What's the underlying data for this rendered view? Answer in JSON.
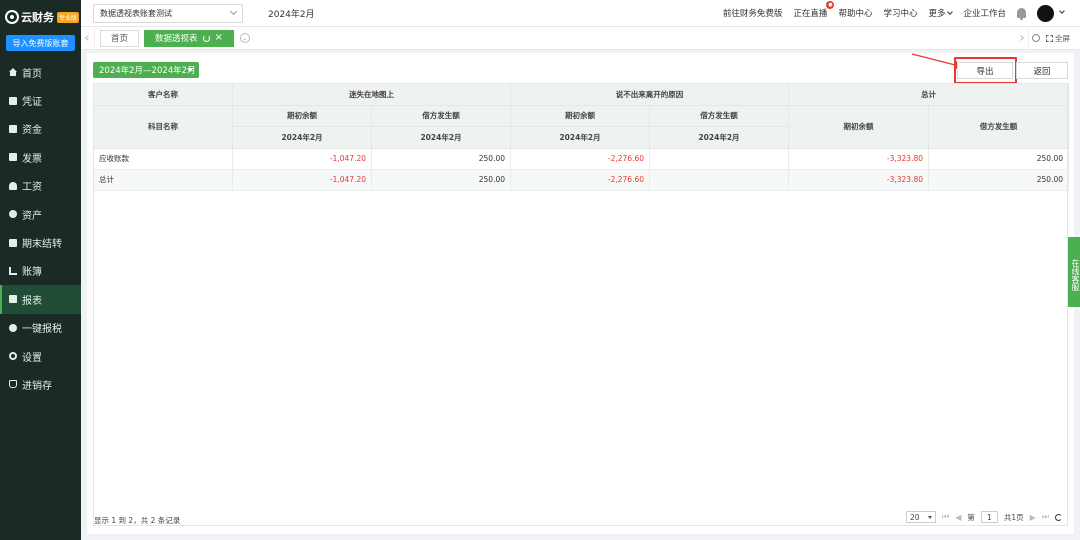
{
  "brand": {
    "name": "云财务",
    "badge": "专业版"
  },
  "sidebar": {
    "import_label": "导入免费版账套",
    "items": [
      {
        "label": "首页",
        "icon": "house-icon"
      },
      {
        "label": "凭证",
        "icon": "document-icon"
      },
      {
        "label": "资金",
        "icon": "wallet-icon"
      },
      {
        "label": "发票",
        "icon": "invoice-icon"
      },
      {
        "label": "工资",
        "icon": "person-icon"
      },
      {
        "label": "资产",
        "icon": "asset-icon"
      },
      {
        "label": "期末结转",
        "icon": "closing-icon"
      },
      {
        "label": "账簿",
        "icon": "ledger-icon"
      },
      {
        "label": "报表",
        "icon": "report-icon",
        "active": true
      },
      {
        "label": "一键报税",
        "icon": "tax-icon"
      },
      {
        "label": "设置",
        "icon": "gear-icon"
      },
      {
        "label": "进销存",
        "icon": "inventory-icon"
      }
    ]
  },
  "topbar": {
    "account": "数据透视表账套测试",
    "period": "2024年2月",
    "links": {
      "free_version": "前往财务免费版",
      "live": "正在直播",
      "help": "帮助中心",
      "learn": "学习中心",
      "more": "更多",
      "workbench": "企业工作台"
    }
  },
  "tabs": {
    "home": "首页",
    "active": "数据透视表",
    "fullscreen": "全屏"
  },
  "toolbar": {
    "period_range": "2024年2月—2024年2月",
    "export": "导出",
    "back": "返回"
  },
  "table": {
    "header_row1": {
      "customer": "客户名称",
      "group1": "迷失在地图上",
      "group2": "说不出来离开的原因",
      "group3": "总计"
    },
    "header_row2": {
      "subject": "科目名称",
      "g1_opening": "期初余额",
      "g1_credit": "借方发生额",
      "g2_opening": "期初余额",
      "g2_credit": "借方发生额",
      "g3_opening": "期初余额",
      "g3_credit": "借方发生额"
    },
    "header_row3": {
      "g1_opening_period": "2024年2月",
      "g1_credit_period": "2024年2月",
      "g2_opening_period": "2024年2月",
      "g2_credit_period": "2024年2月"
    },
    "rows": [
      {
        "name": "应收账款",
        "g1_opening": "-1,047.20",
        "g1_credit": "250.00",
        "g2_opening": "-2,276.60",
        "g2_credit": "",
        "g3_opening": "-3,323.80",
        "g3_credit": "250.00"
      },
      {
        "name": "总计",
        "g1_opening": "-1,047.20",
        "g1_credit": "250.00",
        "g2_opening": "-2,276.60",
        "g2_credit": "",
        "g3_opening": "-3,323.80",
        "g3_credit": "250.00"
      }
    ]
  },
  "footer": {
    "summary": "显示 1 到 2，共 2 条记录",
    "page_size": "20",
    "page_prefix": "第",
    "page_current": "1",
    "page_total": "共1页"
  },
  "service_tab": "在线客服"
}
